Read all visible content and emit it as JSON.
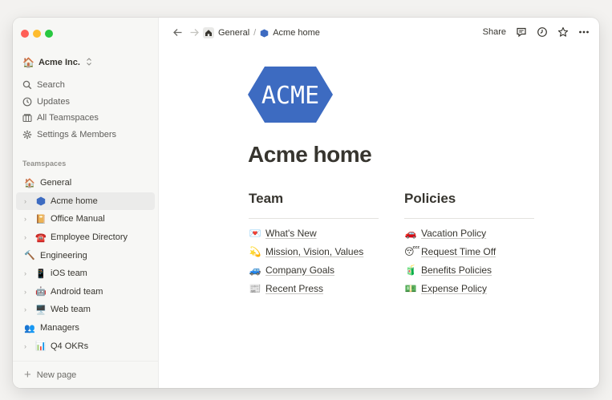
{
  "sidebar": {
    "workspace": {
      "icon": "🏠",
      "name": "Acme Inc."
    },
    "menu": [
      {
        "label": "Search",
        "icon": "search-icon"
      },
      {
        "label": "Updates",
        "icon": "clock-icon"
      },
      {
        "label": "All Teamspaces",
        "icon": "teamspaces-icon"
      },
      {
        "label": "Settings & Members",
        "icon": "gear-icon"
      }
    ],
    "teamspaces_header": "Teamspaces",
    "tree": [
      {
        "label": "General",
        "emoji": "🏠"
      },
      {
        "label": "Acme home",
        "emoji": "🏢"
      },
      {
        "label": "Office Manual",
        "emoji": "📔"
      },
      {
        "label": "Employee Directory",
        "emoji": "☎️"
      },
      {
        "label": "Engineering",
        "emoji": "🔨"
      },
      {
        "label": "iOS team",
        "emoji": "📱"
      },
      {
        "label": "Android team",
        "emoji": "🤖"
      },
      {
        "label": "Web team",
        "emoji": "🖥️"
      },
      {
        "label": "Managers",
        "emoji": "👥"
      },
      {
        "label": "Q4 OKRs",
        "emoji": "📊"
      }
    ],
    "new_page": "New page"
  },
  "topbar": {
    "breadcrumb": {
      "parent": "General",
      "separator": "/",
      "current": "Acme home"
    },
    "share_label": "Share"
  },
  "page": {
    "logo_text": "ACME",
    "title": "Acme home",
    "team": {
      "heading": "Team",
      "links": [
        {
          "emoji": "💌",
          "label": "What's New"
        },
        {
          "emoji": "💫",
          "label": "Mission, Vision, Values"
        },
        {
          "emoji": "🚙",
          "label": "Company Goals"
        },
        {
          "emoji": "📰",
          "label": "Recent Press"
        }
      ]
    },
    "policies": {
      "heading": "Policies",
      "links": [
        {
          "emoji": "🚗",
          "label": "Vacation Policy"
        },
        {
          "emoji": "😴",
          "label": "Request Time Off"
        },
        {
          "emoji": "🧃",
          "label": "Benefits Policies"
        },
        {
          "emoji": "💵",
          "label": "Expense Policy"
        }
      ]
    }
  },
  "colors": {
    "acme_blue": "#3d6bc1",
    "text": "#37352f",
    "sidebar_bg": "#f7f7f5"
  }
}
